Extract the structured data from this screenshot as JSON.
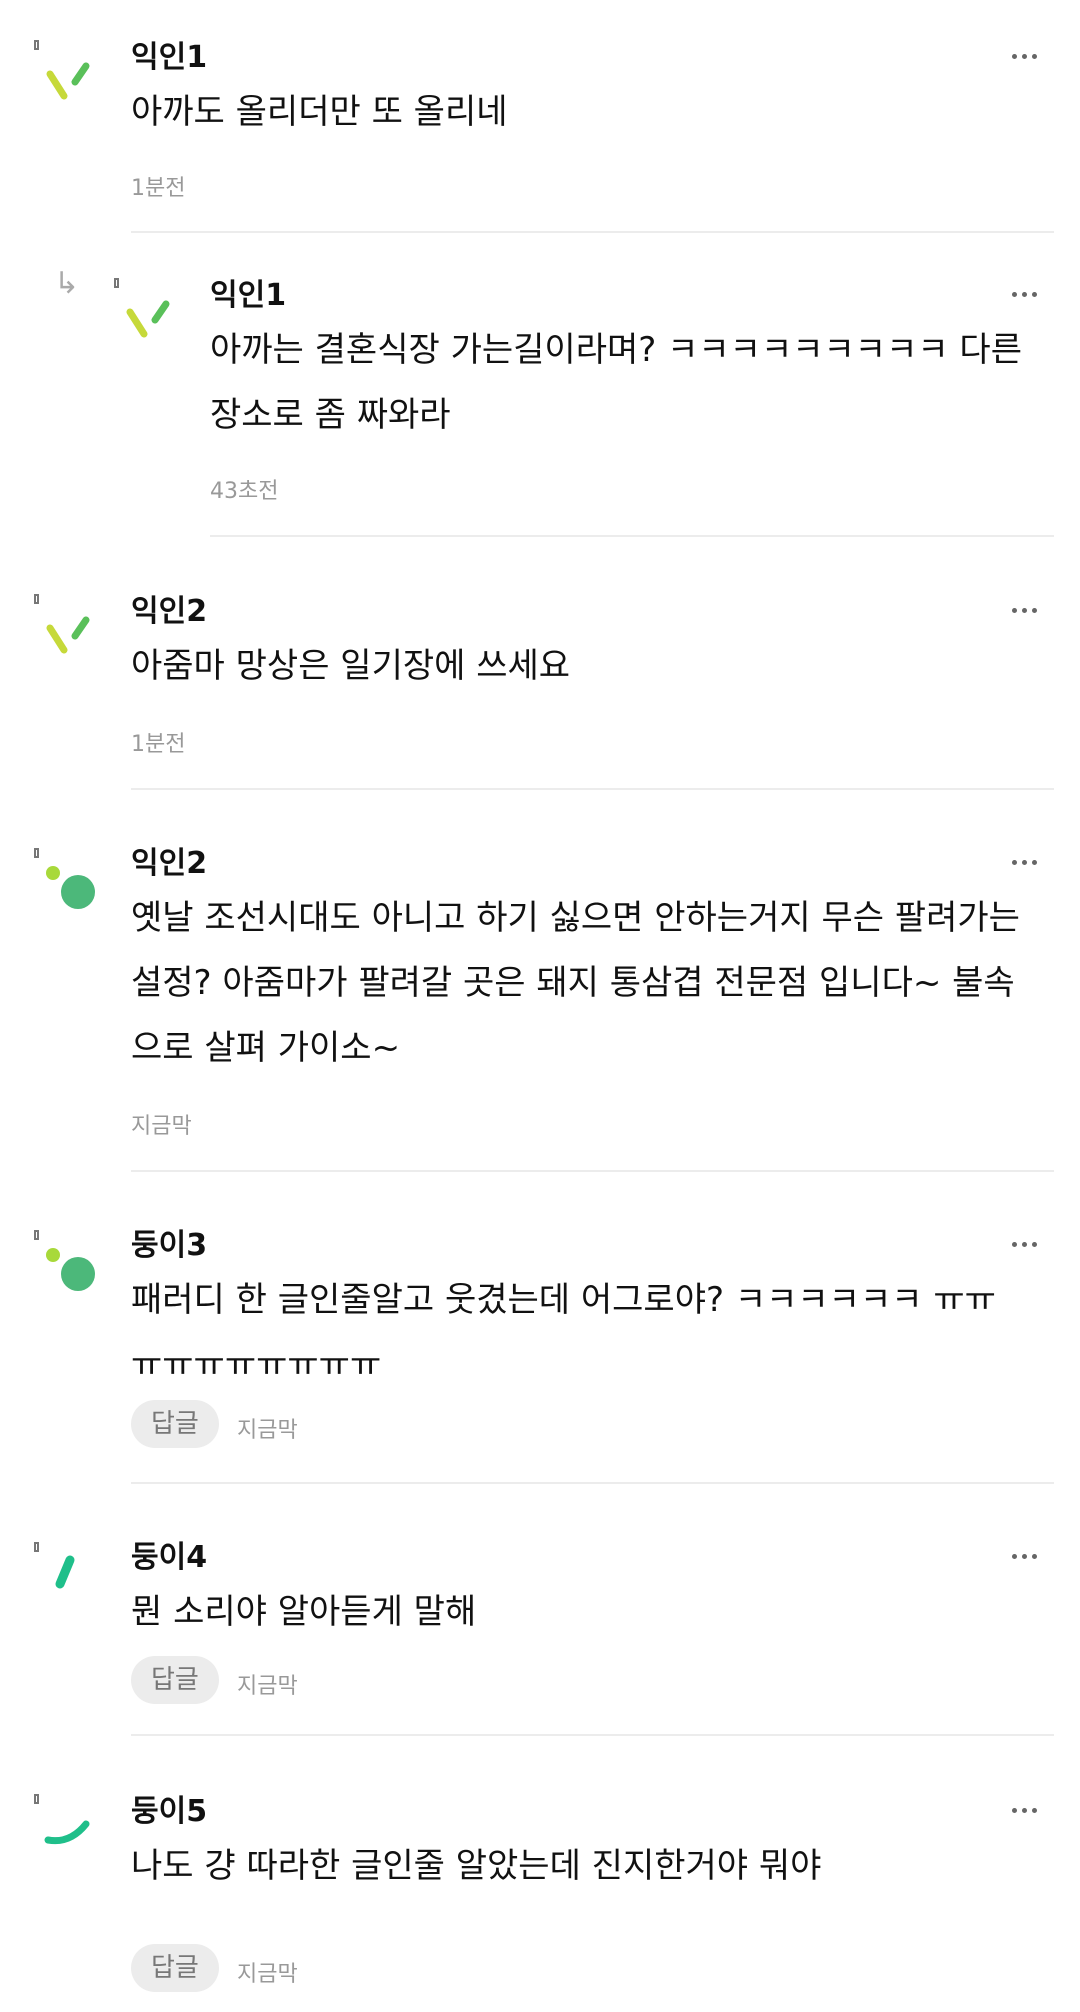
{
  "comments": [
    {
      "author": "익인1",
      "text": "아까도 올리더만 또 올리네",
      "time": "1분전"
    },
    {
      "author": "익인1",
      "text": "아까는 결혼식장 가는길이라며? ㅋㅋㅋㅋㅋㅋㅋㅋㅋ 다른 장소로 좀 짜와라",
      "time": "43초전"
    },
    {
      "author": "익인2",
      "text": "아줌마 망상은 일기장에 쓰세요",
      "time": "1분전"
    },
    {
      "author": "익인2",
      "text": "옛날 조선시대도 아니고 하기 싫으면 안하는거지 무슨 팔려가는 설정? 아줌마가 팔려갈 곳은 돼지 통삼겹 전문점 입니다~ 불속으로 살펴 가이소~",
      "time": "지금막"
    },
    {
      "author": "둥이3",
      "text": "패러디 한 글인줄알고 웃겼는데 어그로야? ㅋㅋㅋㅋㅋㅋ ㅠㅠ ㅠㅠㅠㅠㅠㅠㅠㅠ",
      "time": "지금막",
      "reply_label": "답글"
    },
    {
      "author": "둥이4",
      "text": "뭔 소리야 알아듣게 말해",
      "time": "지금막",
      "reply_label": "답글"
    },
    {
      "author": "둥이5",
      "text": "나도 걍 따라한 글인줄 알았는데 진지한거야 뭐야",
      "time": "지금막",
      "reply_label": "답글"
    }
  ],
  "icons": {
    "more": "more-icon",
    "reply_arrow": "reply-arrow-icon"
  },
  "colors": {
    "avatar_lime": "#c6d93a",
    "avatar_green": "#5ac05a",
    "avatar_teal": "#1fbf8a",
    "avatar_dot": "#4cb87a"
  }
}
